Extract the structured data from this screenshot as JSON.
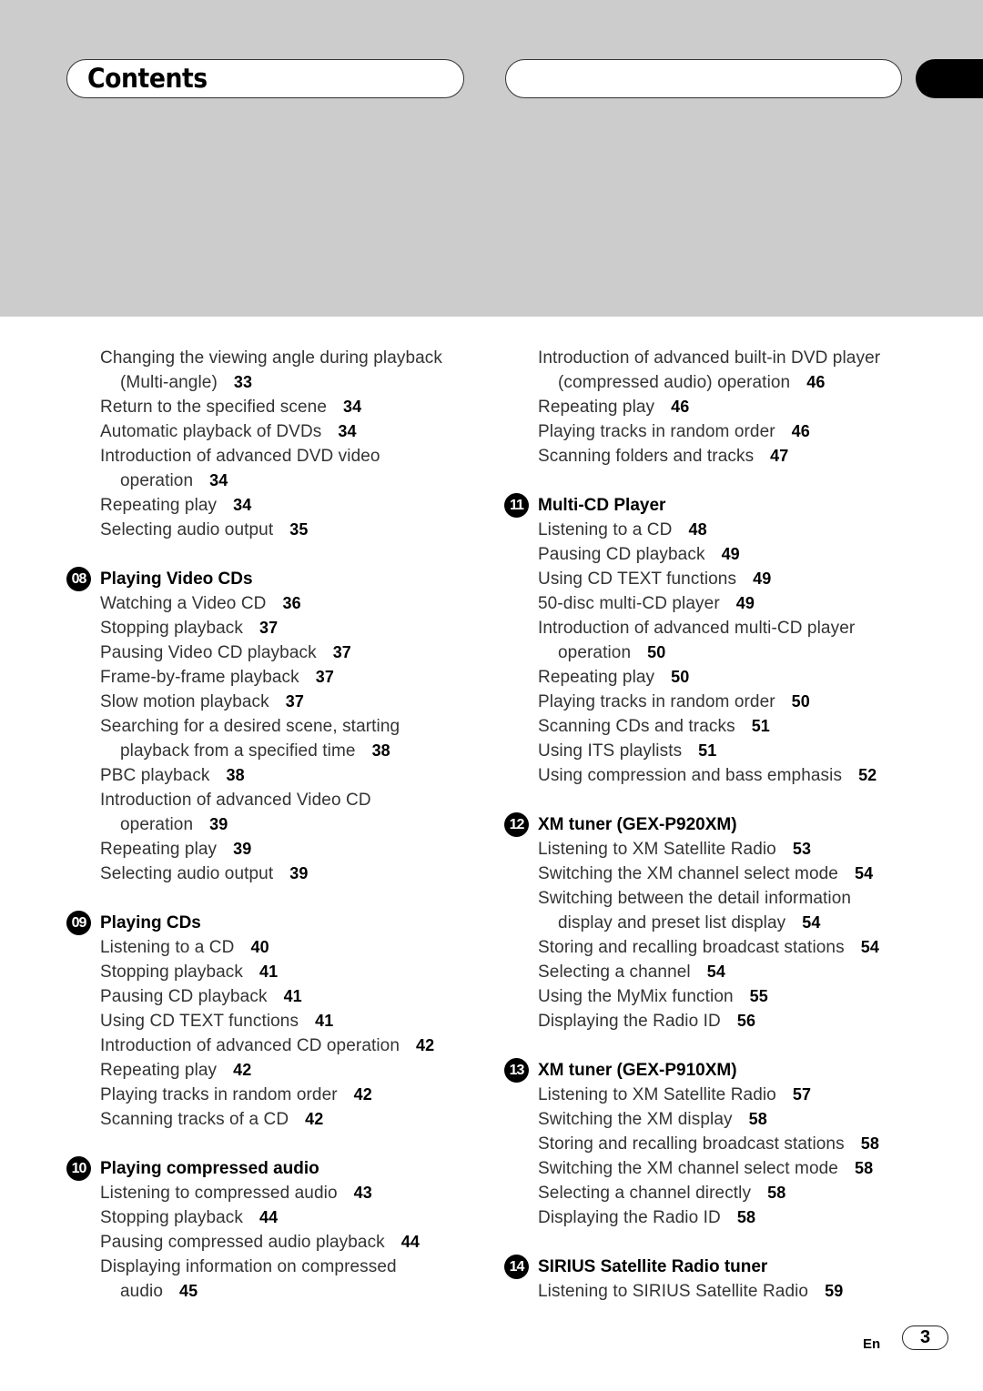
{
  "header": {
    "title": "Contents"
  },
  "columns": {
    "left": [
      {
        "number": null,
        "title": null,
        "entries": [
          {
            "lines": [
              "Changing the viewing angle during playback",
              "(Multi-angle)"
            ],
            "page": "33"
          },
          {
            "lines": [
              "Return to the specified scene"
            ],
            "page": "34"
          },
          {
            "lines": [
              "Automatic playback of DVDs"
            ],
            "page": "34"
          },
          {
            "lines": [
              "Introduction of advanced DVD video",
              "operation"
            ],
            "page": "34"
          },
          {
            "lines": [
              "Repeating play"
            ],
            "page": "34"
          },
          {
            "lines": [
              "Selecting audio output"
            ],
            "page": "35"
          }
        ]
      },
      {
        "number": "08",
        "title": "Playing Video CDs",
        "entries": [
          {
            "lines": [
              "Watching a Video CD"
            ],
            "page": "36"
          },
          {
            "lines": [
              "Stopping playback"
            ],
            "page": "37"
          },
          {
            "lines": [
              "Pausing Video CD playback"
            ],
            "page": "37"
          },
          {
            "lines": [
              "Frame-by-frame playback"
            ],
            "page": "37"
          },
          {
            "lines": [
              "Slow motion playback"
            ],
            "page": "37"
          },
          {
            "lines": [
              "Searching for a desired scene, starting",
              "playback from a specified time"
            ],
            "page": "38"
          },
          {
            "lines": [
              "PBC playback"
            ],
            "page": "38"
          },
          {
            "lines": [
              "Introduction of advanced Video CD",
              "operation"
            ],
            "page": "39"
          },
          {
            "lines": [
              "Repeating play"
            ],
            "page": "39"
          },
          {
            "lines": [
              "Selecting audio output"
            ],
            "page": "39"
          }
        ]
      },
      {
        "number": "09",
        "title": "Playing CDs",
        "entries": [
          {
            "lines": [
              "Listening to a CD"
            ],
            "page": "40"
          },
          {
            "lines": [
              "Stopping playback"
            ],
            "page": "41"
          },
          {
            "lines": [
              "Pausing CD playback"
            ],
            "page": "41"
          },
          {
            "lines": [
              "Using CD TEXT functions"
            ],
            "page": "41"
          },
          {
            "lines": [
              "Introduction of advanced CD operation"
            ],
            "page": "42"
          },
          {
            "lines": [
              "Repeating play"
            ],
            "page": "42"
          },
          {
            "lines": [
              "Playing tracks in random order"
            ],
            "page": "42"
          },
          {
            "lines": [
              "Scanning tracks of a CD"
            ],
            "page": "42"
          }
        ]
      },
      {
        "number": "10",
        "title": "Playing compressed audio",
        "entries": [
          {
            "lines": [
              "Listening to compressed audio"
            ],
            "page": "43"
          },
          {
            "lines": [
              "Stopping playback"
            ],
            "page": "44"
          },
          {
            "lines": [
              "Pausing compressed audio playback"
            ],
            "page": "44"
          },
          {
            "lines": [
              "Displaying information on compressed",
              "audio"
            ],
            "page": "45"
          }
        ]
      }
    ],
    "right": [
      {
        "number": null,
        "title": null,
        "entries": [
          {
            "lines": [
              "Introduction of advanced built-in DVD player",
              "(compressed audio) operation"
            ],
            "page": "46"
          },
          {
            "lines": [
              "Repeating play"
            ],
            "page": "46"
          },
          {
            "lines": [
              "Playing tracks in random order"
            ],
            "page": "46"
          },
          {
            "lines": [
              "Scanning folders and tracks"
            ],
            "page": "47"
          }
        ]
      },
      {
        "number": "11",
        "title": "Multi-CD Player",
        "entries": [
          {
            "lines": [
              "Listening to a CD"
            ],
            "page": "48"
          },
          {
            "lines": [
              "Pausing CD playback"
            ],
            "page": "49"
          },
          {
            "lines": [
              "Using CD TEXT functions"
            ],
            "page": "49"
          },
          {
            "lines": [
              "50-disc multi-CD player"
            ],
            "page": "49"
          },
          {
            "lines": [
              "Introduction of advanced multi-CD player",
              "operation"
            ],
            "page": "50"
          },
          {
            "lines": [
              "Repeating play"
            ],
            "page": "50"
          },
          {
            "lines": [
              "Playing tracks in random order"
            ],
            "page": "50"
          },
          {
            "lines": [
              "Scanning CDs and tracks"
            ],
            "page": "51"
          },
          {
            "lines": [
              "Using ITS playlists"
            ],
            "page": "51"
          },
          {
            "lines": [
              "Using compression and bass emphasis"
            ],
            "page": "52"
          }
        ]
      },
      {
        "number": "12",
        "title": "XM tuner (GEX-P920XM)",
        "entries": [
          {
            "lines": [
              "Listening to XM Satellite Radio"
            ],
            "page": "53"
          },
          {
            "lines": [
              "Switching the XM channel select mode"
            ],
            "page": "54"
          },
          {
            "lines": [
              "Switching between the detail information",
              "display and preset list display"
            ],
            "page": "54"
          },
          {
            "lines": [
              "Storing and recalling broadcast stations"
            ],
            "page": "54"
          },
          {
            "lines": [
              "Selecting a channel"
            ],
            "page": "54"
          },
          {
            "lines": [
              "Using the MyMix function"
            ],
            "page": "55"
          },
          {
            "lines": [
              "Displaying the Radio ID"
            ],
            "page": "56"
          }
        ]
      },
      {
        "number": "13",
        "title": "XM tuner (GEX-P910XM)",
        "entries": [
          {
            "lines": [
              "Listening to XM Satellite Radio"
            ],
            "page": "57"
          },
          {
            "lines": [
              "Switching the XM display"
            ],
            "page": "58"
          },
          {
            "lines": [
              "Storing and recalling broadcast stations"
            ],
            "page": "58"
          },
          {
            "lines": [
              "Switching the XM channel select mode"
            ],
            "page": "58"
          },
          {
            "lines": [
              "Selecting a channel directly"
            ],
            "page": "58"
          },
          {
            "lines": [
              "Displaying the Radio ID"
            ],
            "page": "58"
          }
        ]
      },
      {
        "number": "14",
        "title": "SIRIUS Satellite Radio tuner",
        "entries": [
          {
            "lines": [
              "Listening to SIRIUS Satellite Radio"
            ],
            "page": "59"
          }
        ]
      }
    ]
  },
  "footer": {
    "language": "En",
    "page_number": "3"
  }
}
